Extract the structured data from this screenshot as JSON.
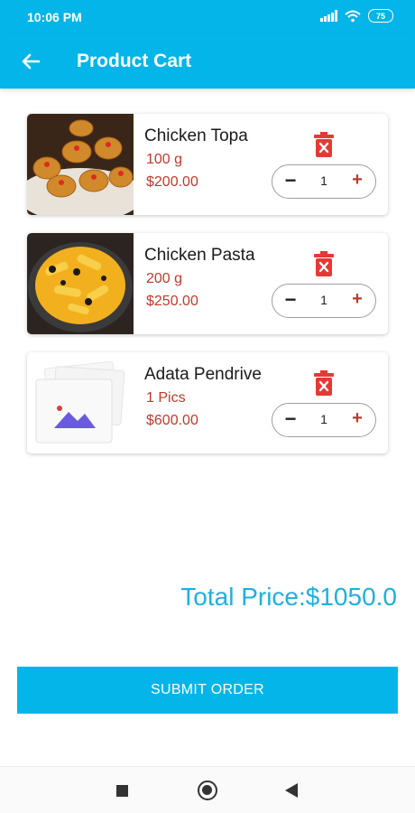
{
  "status_bar": {
    "time": "10:06 PM",
    "battery": "75"
  },
  "app_bar": {
    "title": "Product Cart",
    "back_icon": "arrow-left-icon"
  },
  "cart": {
    "items": [
      {
        "name": "Chicken Topa",
        "quantity_label": "100 g",
        "price": "$200.00",
        "count": "1",
        "minus": "−",
        "plus": "+"
      },
      {
        "name": "Chicken Pasta",
        "quantity_label": "200 g",
        "price": "$250.00",
        "count": "1",
        "minus": "−",
        "plus": "+"
      },
      {
        "name": "Adata Pendrive",
        "quantity_label": "1 Pics",
        "price": "$600.00",
        "count": "1",
        "minus": "−",
        "plus": "+"
      }
    ]
  },
  "total": {
    "label": "Total Price:$1050.0"
  },
  "submit": {
    "label": "SUBMIT ORDER"
  },
  "colors": {
    "accent": "#03b5e8",
    "price": "#c0392b",
    "total_text": "#1fb0dd",
    "delete": "#e53935"
  }
}
